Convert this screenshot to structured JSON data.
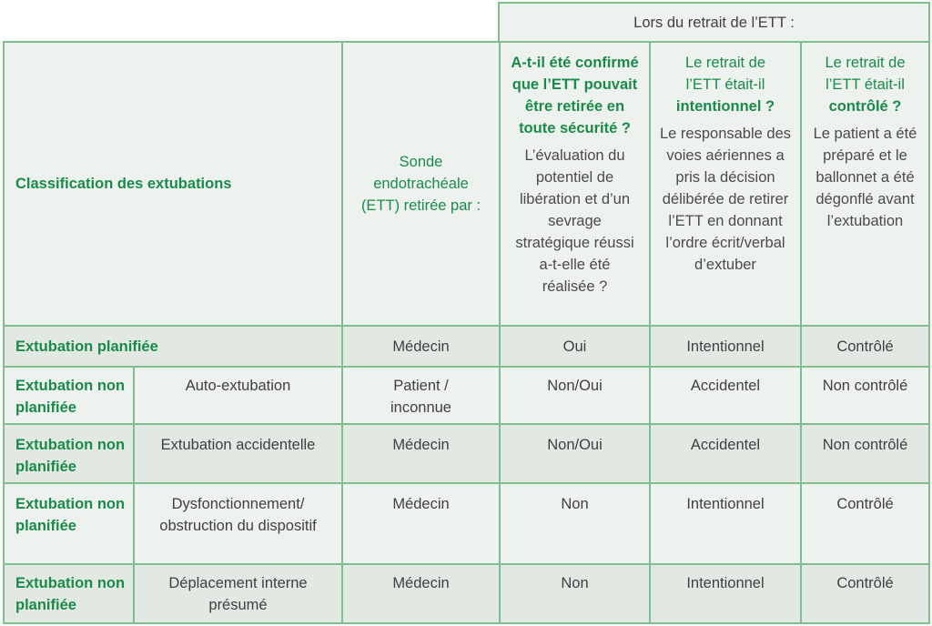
{
  "table": {
    "group_header": "Lors du retrait de l’ETT :",
    "col_classification": "Classification des extubations",
    "col_removed_by": "Sonde endotrachéale (ETT) retirée par :",
    "col_safe": {
      "question": "A-t-il été confirmé que l’ETT pouvait être retirée en toute sécurité ?",
      "detail": "L’évaluation du potentiel de libération et d’un sevrage stratégique réussi a-t-elle été réalisée ?"
    },
    "col_intentional": {
      "question_plain": "Le retrait de l’ETT était-il",
      "question_bold": "intentionnel ?",
      "detail": "Le responsable des voies aériennes a pris la décision délibérée de retirer l’ETT en donnant l’ordre écrit/verbal d’extuber"
    },
    "col_controlled": {
      "question_plain": "Le retrait de l’ETT était-il",
      "question_bold": "contrôlé ?",
      "detail": "Le patient a été préparé et le ballonnet a été dégonflé avant l’extubation"
    },
    "rows": [
      {
        "category": "Extubation planifiée",
        "subtype": "",
        "removed_by": "Médecin",
        "safe": "Oui",
        "intentional": "Intentionnel",
        "controlled": "Contrôlé"
      },
      {
        "category": "Extubation non planifiée",
        "subtype": "Auto-extubation",
        "removed_by": "Patient / inconnue",
        "safe": "Non/Oui",
        "intentional": "Accidentel",
        "controlled": "Non contrôlé"
      },
      {
        "category": "Extubation non planifiée",
        "subtype": "Extubation accidentelle",
        "removed_by": "Médecin",
        "safe": "Non/Oui",
        "intentional": "Accidentel",
        "controlled": "Non contrôlé"
      },
      {
        "category": "Extubation non planifiée",
        "subtype": "Dysfonctionnement/ obstruction du dispositif",
        "removed_by": "Médecin",
        "safe": "Non",
        "intentional": "Intentionnel",
        "controlled": "Contrôlé"
      },
      {
        "category": "Extubation non planifiée",
        "subtype": "Déplacement interne présumé",
        "removed_by": "Médecin",
        "safe": "Non",
        "intentional": "Intentionnel",
        "controlled": "Contrôlé"
      }
    ]
  }
}
